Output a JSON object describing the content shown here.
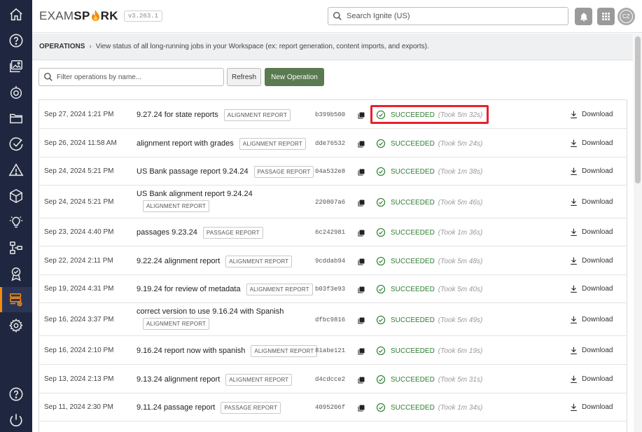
{
  "app": {
    "logo": {
      "part1": "EXAM",
      "part2": "SP",
      "part3": "RK"
    },
    "version": "v3.263.1",
    "search_placeholder": "Search Ignite (US)",
    "avatar_initials": "CZ"
  },
  "sidebar": {
    "items": [
      {
        "icon": "home-icon"
      },
      {
        "icon": "help-icon"
      },
      {
        "icon": "images-icon"
      },
      {
        "icon": "target-icon"
      },
      {
        "icon": "folder-icon"
      },
      {
        "icon": "check-circle-icon"
      },
      {
        "icon": "warning-icon"
      },
      {
        "icon": "cube-icon"
      },
      {
        "icon": "lightbulb-icon"
      },
      {
        "icon": "hierarchy-icon"
      },
      {
        "icon": "badge-icon"
      },
      {
        "icon": "operations-icon",
        "active": true
      },
      {
        "icon": "settings-icon"
      }
    ],
    "bottom": [
      {
        "icon": "help-icon"
      },
      {
        "icon": "power-icon"
      }
    ]
  },
  "breadcrumb": {
    "crumb": "OPERATIONS",
    "description": "View status of all long-running jobs in your Workspace (ex: report generation, content imports, and exports)."
  },
  "toolbar": {
    "filter_placeholder": "Filter operations by name...",
    "refresh_label": "Refresh",
    "new_label": "New Operation"
  },
  "operations": [
    {
      "date": "Sep 27, 2024 1:21 PM",
      "name": "9.27.24 for state reports",
      "tag": "ALIGNMENT REPORT",
      "id": "b399b500",
      "status": "SUCCEEDED",
      "took": "(Took 5m 32s)",
      "download": "Download"
    },
    {
      "date": "Sep 26, 2024 11:58 AM",
      "name": "alignment report with grades",
      "tag": "ALIGNMENT REPORT",
      "id": "dde76532",
      "status": "SUCCEEDED",
      "took": "(Took 5m 24s)",
      "download": "Download"
    },
    {
      "date": "Sep 24, 2024 5:21 PM",
      "name": "US Bank passage report 9.24.24",
      "tag": "PASSAGE REPORT",
      "id": "04a532e8",
      "status": "SUCCEEDED",
      "took": "(Took 1m 38s)",
      "download": "Download"
    },
    {
      "date": "Sep 24, 2024 5:21 PM",
      "name": "US Bank alignment report 9.24.24",
      "tag": "ALIGNMENT REPORT",
      "id": "220807a6",
      "status": "SUCCEEDED",
      "took": "(Took 5m 46s)",
      "download": "Download"
    },
    {
      "date": "Sep 23, 2024 4:40 PM",
      "name": "passages 9.23.24",
      "tag": "PASSAGE REPORT",
      "id": "6c242981",
      "status": "SUCCEEDED",
      "took": "(Took 1m 36s)",
      "download": "Download"
    },
    {
      "date": "Sep 22, 2024 2:11 PM",
      "name": "9.22.24 alignment report",
      "tag": "ALIGNMENT REPORT",
      "id": "9cddab94",
      "status": "SUCCEEDED",
      "took": "(Took 5m 48s)",
      "download": "Download"
    },
    {
      "date": "Sep 19, 2024 4:31 PM",
      "name": "9.19.24 for review of metadata",
      "tag": "ALIGNMENT REPORT",
      "id": "b03f3e93",
      "status": "SUCCEEDED",
      "took": "(Took 5m 40s)",
      "download": "Download"
    },
    {
      "date": "Sep 16, 2024 3:37 PM",
      "name": "correct version to use 9.16.24 with Spanish",
      "tag": "ALIGNMENT REPORT",
      "id": "dfbc9816",
      "status": "SUCCEEDED",
      "took": "(Took 5m 49s)",
      "download": "Download"
    },
    {
      "date": "Sep 16, 2024 2:10 PM",
      "name": "9.16.24 report now with spanish",
      "tag": "ALIGNMENT REPORT",
      "id": "81abe121",
      "status": "SUCCEEDED",
      "took": "(Took 6m 19s)",
      "download": "Download"
    },
    {
      "date": "Sep 13, 2024 2:13 PM",
      "name": "9.13.24 alignment report",
      "tag": "ALIGNMENT REPORT",
      "id": "d4cdcce2",
      "status": "SUCCEEDED",
      "took": "(Took 5m 31s)",
      "download": "Download"
    },
    {
      "date": "Sep 11, 2024 2:30 PM",
      "name": "9.11.24 passage report",
      "tag": "PASSAGE REPORT",
      "id": "4095206f",
      "status": "SUCCEEDED",
      "took": "(Took 1m 34s)",
      "download": "Download"
    }
  ],
  "colors": {
    "accent": "#f28b12",
    "primary_button": "#5a7a52",
    "success": "#2e7d32",
    "highlight": "#e8202f"
  }
}
